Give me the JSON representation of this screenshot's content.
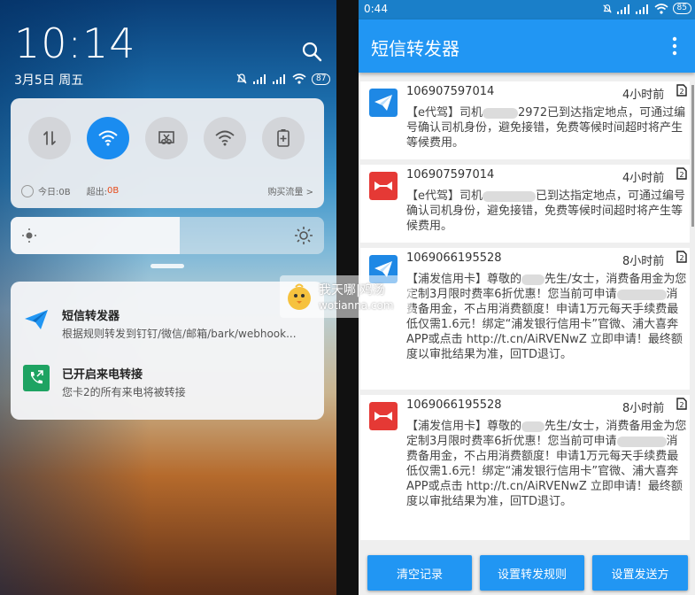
{
  "left": {
    "time": "10:14",
    "date": "3月5日 周五",
    "battery": "87",
    "quick_settings": {
      "tiles": [
        {
          "name": "data-toggle",
          "active": false
        },
        {
          "name": "wifi",
          "active": true
        },
        {
          "name": "screenshot",
          "active": false
        },
        {
          "name": "hotspot",
          "active": false
        },
        {
          "name": "battery-saver",
          "active": false
        }
      ],
      "today_label": "今日:0B",
      "over_label": "超出:",
      "over_value": "0B",
      "buy_label": "购买流量 >"
    },
    "brightness_level": 0.54,
    "notifications": [
      {
        "title": "短信转发器",
        "text": "根据规则转发到钉钉/微信/邮箱/bark/webhook..."
      },
      {
        "title": "已开启来电转接",
        "text": "您卡2的所有来电将被转接"
      }
    ]
  },
  "right": {
    "status": {
      "time": "0:44",
      "battery": "85"
    },
    "app_title": "短信转发器",
    "messages": [
      {
        "number": "106907597014",
        "time": "4小时前",
        "sim": "2",
        "icon": "blue",
        "body_a": "【e代驾】司机",
        "body_b": "2972已到达指定地点，可通过编号确认司机身份，避免接错，免费等候时间超时将产生等候费用。"
      },
      {
        "number": "106907597014",
        "time": "4小时前",
        "sim": "2",
        "icon": "red",
        "body_a": "【e代驾】司机",
        "body_b": "已到达指定地点，可通过编号确认司机身份，避免接错，免费等候时间超时将产生等候费用。"
      },
      {
        "number": "1069066195528",
        "time": "8小时前",
        "sim": "2",
        "icon": "blue",
        "body_a": "【浦发信用卡】尊敬的",
        "body_b": "先生/女士，消费备用金为您定制3月限时费率6折优惠！您当前可申请",
        "body_c": "消费备用金，不占用消费额度！申请1万元每天手续费最低仅需1.6元！绑定“浦发银行信用卡”官微、浦大喜奔APP或点击 http://t.cn/AiRVENwZ 立即申请！最终额度以审批结果为准，回TD退订。"
      },
      {
        "number": "1069066195528",
        "time": "8小时前",
        "sim": "2",
        "icon": "red",
        "body_a": "【浦发信用卡】尊敬的",
        "body_b": "先生/女士，消费备用金为您定制3月限时费率6折优惠！您当前可申请",
        "body_c": "消费备用金，不占用消费额度！申请1万元每天手续费最低仅需1.6元！绑定“浦发银行信用卡”官微、浦大喜奔APP或点击 http://t.cn/AiRVENwZ 立即申请！最终额度以审批结果为准，回TD退订。"
      }
    ],
    "buttons": {
      "clear": "清空记录",
      "rules": "设置转发规则",
      "senders": "设置发送方"
    }
  },
  "watermark": {
    "line1": "我天哪|鸡汤",
    "line2": "wotianna.com"
  },
  "colors": {
    "primary": "#2196f3",
    "active_tile": "#1a8cf0",
    "over_value": "#e64a19"
  }
}
